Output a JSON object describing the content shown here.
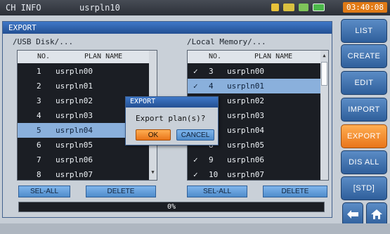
{
  "topbar": {
    "title": "CH INFO",
    "filename": "usrpln10",
    "clock": "03:40:08",
    "status_icons": [
      "usb-icon",
      "network-icon",
      "antenna-icon",
      "battery-icon"
    ]
  },
  "window": {
    "title": "EXPORT",
    "left": {
      "path": "/USB Disk/...",
      "col_no": "NO.",
      "col_name": "PLAN NAME",
      "rows": [
        {
          "no": "1",
          "name": "usrpln00"
        },
        {
          "no": "2",
          "name": "usrpln01"
        },
        {
          "no": "3",
          "name": "usrpln02"
        },
        {
          "no": "4",
          "name": "usrpln03"
        },
        {
          "no": "5",
          "name": "usrpln04"
        },
        {
          "no": "6",
          "name": "usrpln05"
        },
        {
          "no": "7",
          "name": "usrpln06"
        },
        {
          "no": "8",
          "name": "usrpln07"
        }
      ],
      "selected_row": "5",
      "sel_all": "SEL-ALL",
      "delete": "DELETE"
    },
    "right": {
      "path": "/Local Memory/...",
      "col_no": "NO.",
      "col_name": "PLAN NAME",
      "rows": [
        {
          "check": "✓",
          "no": "3",
          "name": "usrpln00"
        },
        {
          "check": "✓",
          "no": "4",
          "name": "usrpln01"
        },
        {
          "check": "",
          "no": "5",
          "name": "usrpln02"
        },
        {
          "check": "",
          "no": "6",
          "name": "usrpln03"
        },
        {
          "check": "",
          "no": "7",
          "name": "usrpln04"
        },
        {
          "check": "",
          "no": "8",
          "name": "usrpln05"
        },
        {
          "check": "✓",
          "no": "9",
          "name": "usrpln06"
        },
        {
          "check": "✓",
          "no": "10",
          "name": "usrpln07"
        }
      ],
      "selected_row": "4",
      "sel_all": "SEL-ALL",
      "delete": "DELETE"
    },
    "progress": "0%"
  },
  "dialog": {
    "title": "EXPORT",
    "message": "Export plan(s)?",
    "ok": "OK",
    "cancel": "CANCEL"
  },
  "side_buttons": {
    "list": "LIST",
    "create": "CREATE",
    "edit": "EDIT",
    "import": "IMPORT",
    "export": "EXPORT",
    "dis_all": "DIS ALL",
    "std": "[STD]",
    "back_icon": "back-arrow-icon",
    "home_icon": "home-icon"
  },
  "colors": {
    "accent_orange": "#e9751a",
    "button_blue": "#2f5f9b",
    "selection": "#8ab0dc"
  }
}
